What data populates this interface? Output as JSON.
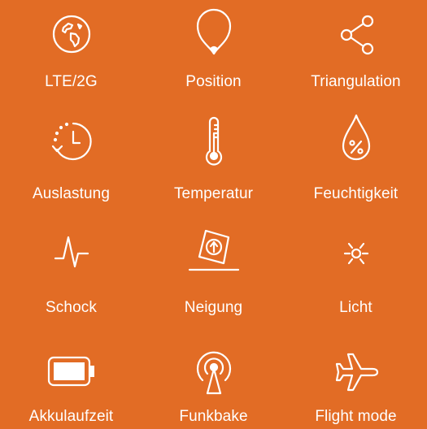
{
  "background_color": "#e26c25",
  "text_color": "#ffffff",
  "features": [
    {
      "label": "LTE/2G",
      "icon": "globe-icon"
    },
    {
      "label": "Position",
      "icon": "location-pin-icon"
    },
    {
      "label": "Triangulation",
      "icon": "share-nodes-icon"
    },
    {
      "label": "Auslastung",
      "icon": "clock-refresh-icon"
    },
    {
      "label": "Temperatur",
      "icon": "thermometer-icon"
    },
    {
      "label": "Feuchtigkeit",
      "icon": "humidity-drop-icon"
    },
    {
      "label": "Schock",
      "icon": "pulse-wave-icon"
    },
    {
      "label": "Neigung",
      "icon": "tilt-icon"
    },
    {
      "label": "Licht",
      "icon": "light-sun-icon"
    },
    {
      "label": "Akkulaufzeit",
      "icon": "battery-icon"
    },
    {
      "label": "Funkbake",
      "icon": "radio-beacon-icon"
    },
    {
      "label": "Flight mode",
      "icon": "airplane-icon"
    }
  ]
}
